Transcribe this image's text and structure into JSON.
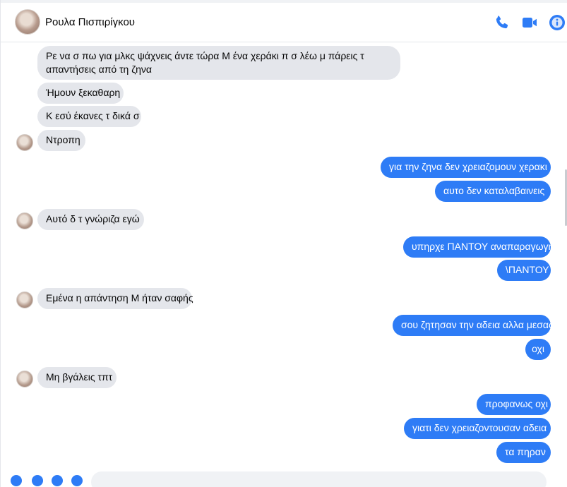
{
  "header": {
    "contact_name": "Ρουλα Πισπιρίγκου",
    "icons": [
      "phone-icon",
      "video-camera-icon",
      "info-icon"
    ],
    "accent": "#2e7cf6"
  },
  "messages": [
    {
      "side": "in",
      "lines": [
        "Ρε να σ πω για μλκς ψάχνεις άντε τώρα Μ ένα χεράκι π σ λέω μ πάρεις τ",
        "απαντήσεις από τη ζηνα"
      ]
    },
    {
      "side": "in",
      "lines": [
        "Ήμουν ξεκαθαρη"
      ]
    },
    {
      "side": "in",
      "lines": [
        "Κ εσύ έκανες τ δικά σ"
      ]
    },
    {
      "side": "in",
      "lines": [
        "Ντροπη"
      ]
    },
    {
      "side": "out",
      "lines": [
        "για την ζηνα δεν χρειαζομουν χερακι"
      ]
    },
    {
      "side": "out",
      "lines": [
        "αυτο δεν καταλαβαινεις"
      ]
    },
    {
      "side": "in",
      "lines": [
        "Αυτό δ τ γνώριζα εγώ"
      ]
    },
    {
      "side": "out",
      "lines": [
        "υπηρχε ΠΑΝΤΟΥ αναπαραγωγη"
      ]
    },
    {
      "side": "out",
      "lines": [
        "\\ΠΑΝΤΟΥ"
      ]
    },
    {
      "side": "in",
      "lines": [
        "Εμένα η απάντηση Μ ήταν σαφής"
      ]
    },
    {
      "side": "out",
      "lines": [
        "σου ζητησαν την αδεια αλλα μεσας"
      ]
    },
    {
      "side": "out",
      "lines": [
        "οχι"
      ]
    },
    {
      "side": "in",
      "lines": [
        "Μη βγάλεις τπτ"
      ]
    },
    {
      "side": "out",
      "lines": [
        "προφανως οχι"
      ]
    },
    {
      "side": "out",
      "lines": [
        "γιατι δεν χρειαζοντουσαν αδεια"
      ]
    },
    {
      "side": "out",
      "lines": [
        "τα πηραν"
      ]
    }
  ]
}
